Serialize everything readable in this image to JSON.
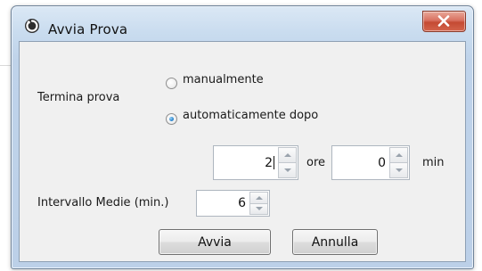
{
  "window": {
    "title": "Avvia Prova"
  },
  "termina": {
    "label": "Termina prova",
    "options": [
      {
        "label": "manualmente",
        "checked": false
      },
      {
        "label": "automaticamente dopo",
        "checked": true
      }
    ]
  },
  "duration": {
    "hours_value": "2",
    "hours_unit": "ore",
    "minutes_value": "0",
    "minutes_unit": "min"
  },
  "intervallo": {
    "label": "Intervallo Medie (min.)",
    "value": "6"
  },
  "buttons": {
    "start": "Avvia",
    "cancel": "Annulla"
  },
  "colors": {
    "close_button": "#d3563f",
    "radio_selected": "#2b86cf"
  }
}
